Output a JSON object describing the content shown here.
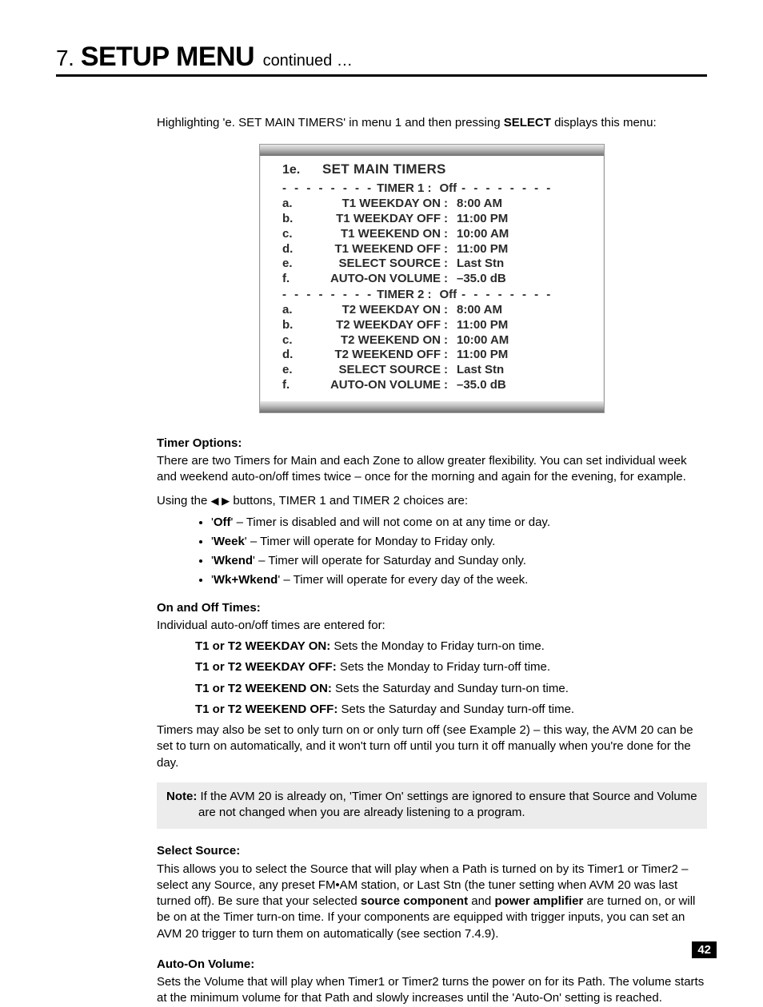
{
  "header": {
    "num": "7.",
    "title": "SETUP MENU",
    "cont": "continued …"
  },
  "intro": {
    "pre": "Highlighting 'e. SET MAIN TIMERS' in menu 1 and then pressing ",
    "bold": "SELECT",
    "post": " displays this menu:"
  },
  "menu": {
    "idx": "1e.",
    "title": "SET MAIN TIMERS",
    "timer1": {
      "label": "TIMER 1 :",
      "value": "Off"
    },
    "timer2": {
      "label": "TIMER 2 :",
      "value": "Off"
    },
    "rows1": [
      {
        "ltr": "a.",
        "lab": "T1 WEEKDAY ON",
        "val": "8:00 AM"
      },
      {
        "ltr": "b.",
        "lab": "T1 WEEKDAY OFF",
        "val": "11:00 PM"
      },
      {
        "ltr": "c.",
        "lab": "T1 WEEKEND ON",
        "val": "10:00 AM"
      },
      {
        "ltr": "d.",
        "lab": "T1 WEEKEND OFF",
        "val": "11:00 PM"
      },
      {
        "ltr": "e.",
        "lab": "SELECT SOURCE",
        "val": "Last Stn"
      },
      {
        "ltr": "f.",
        "lab": "AUTO-ON VOLUME",
        "val": "–35.0 dB"
      }
    ],
    "rows2": [
      {
        "ltr": "a.",
        "lab": "T2 WEEKDAY ON",
        "val": "8:00 AM"
      },
      {
        "ltr": "b.",
        "lab": "T2 WEEKDAY OFF",
        "val": "11:00 PM"
      },
      {
        "ltr": "c.",
        "lab": "T2 WEEKEND ON",
        "val": "10:00 AM"
      },
      {
        "ltr": "d.",
        "lab": "T2 WEEKEND OFF",
        "val": "11:00 PM"
      },
      {
        "ltr": "e.",
        "lab": "SELECT SOURCE",
        "val": "Last Stn"
      },
      {
        "ltr": "f.",
        "lab": "AUTO-ON VOLUME",
        "val": "–35.0 dB"
      }
    ]
  },
  "timer_options": {
    "head": "Timer Options:",
    "p1": "There are two Timers for Main and each Zone to allow greater flexibility. You can set individual week and weekend auto-on/off times twice – once for the morning and again for the evening, for example.",
    "p2_pre": "Using the ",
    "p2_arrows": "◀ ▶",
    "p2_post": " buttons, TIMER 1 and TIMER 2 choices are:",
    "bullets": [
      {
        "b": "Off",
        "t": "' – Timer is disabled and will not come on at any time or day."
      },
      {
        "b": "Week",
        "t": "' – Timer will operate for Monday to Friday only."
      },
      {
        "b": "Wkend",
        "t": "' – Timer will operate for Saturday and Sunday only."
      },
      {
        "b": "Wk+Wkend",
        "t": "' – Timer will operate for every day of the week."
      }
    ]
  },
  "onoff": {
    "head": "On and Off Times:",
    "p1": "Individual auto-on/off times are entered for:",
    "defs": [
      {
        "b": "T1 or T2 WEEKDAY ON:",
        "t": "  Sets the Monday to Friday turn-on time."
      },
      {
        "b": "T1 or T2 WEEKDAY OFF:",
        "t": "  Sets the Monday to Friday turn-off time."
      },
      {
        "b": "T1 or T2 WEEKEND ON:",
        "t": "  Sets the Saturday and Sunday turn-on time."
      },
      {
        "b": "T1 or T2 WEEKEND OFF:",
        "t": "  Sets the Saturday and Sunday turn-off time."
      }
    ],
    "p2": "Timers may also be set to only turn on or only turn off (see Example 2) – this way, the AVM 20 can be set to turn on automatically, and it won't turn off until you turn it off manually when you're done for the day."
  },
  "note": {
    "b": "Note:",
    "t": "  If the AVM 20 is already on, 'Timer On' settings are ignored to ensure that Source and Volume are not changed when you are already listening to a program."
  },
  "select_source": {
    "head": "Select Source:",
    "p_pre": "This allows you to select the Source that will play when a Path is turned on by its Timer1 or Timer2 – select any Source, any preset FM•AM station, or Last Stn (the tuner setting when AVM 20 was last turned off). Be sure that your selected ",
    "b1": "source component",
    "mid": " and ",
    "b2": "power amplifier",
    "p_post": " are turned on, or will be on at the Timer turn-on time. If your components are equipped with trigger inputs, you can set an AVM 20 trigger to turn them on automatically (see section 7.4.9)."
  },
  "auto_on": {
    "head": "Auto-On Volume:",
    "p": "Sets the Volume that will play when Timer1 or Timer2 turns the power on for its Path. The volume starts at the minimum volume for that Path and slowly increases until the 'Auto-On' setting is reached."
  },
  "page_num": "42"
}
